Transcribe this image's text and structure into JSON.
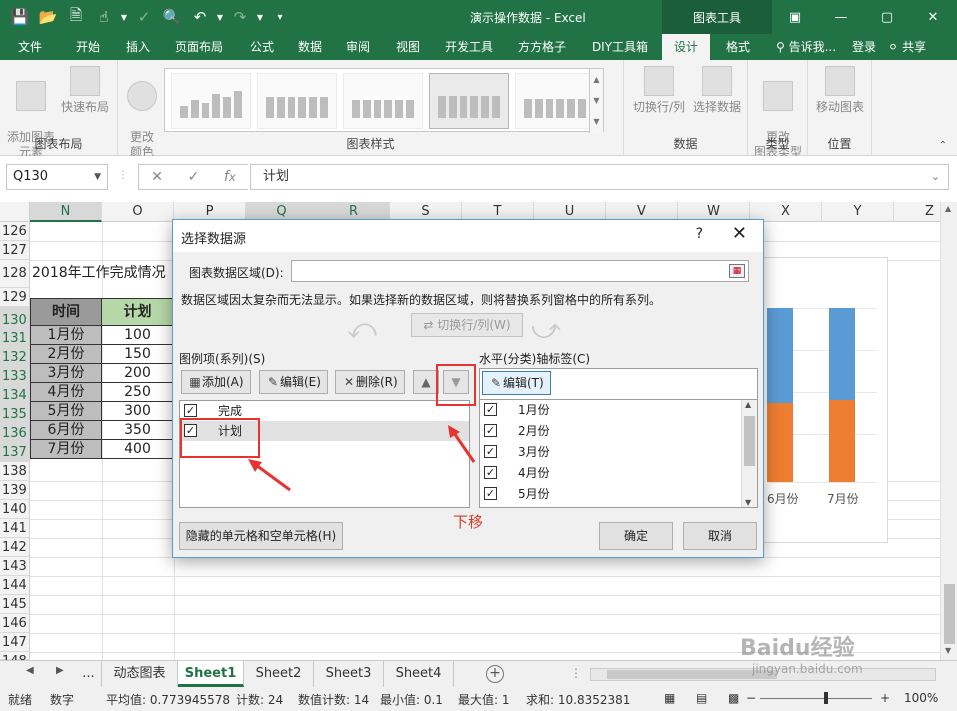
{
  "window": {
    "title": "演示操作数据 - Excel",
    "context_tab": "图表工具"
  },
  "ribbon_tabs": [
    "文件",
    "开始",
    "插入",
    "页面布局",
    "公式",
    "数据",
    "审阅",
    "视图",
    "开发工具",
    "方方格子",
    "DIY工具箱",
    "设计",
    "格式"
  ],
  "active_tab": "设计",
  "tell_me": "告诉我...",
  "login": "登录",
  "share": "共享",
  "ribbon": {
    "add_chart_element": "添加图表\n元素",
    "quick_layout": "快速布局",
    "change_colors": "更改\n颜色",
    "group_layouts": "图表布局",
    "group_styles": "图表样式",
    "switch_row_col": "切换行/列",
    "select_data": "选择数据",
    "group_data": "数据",
    "change_type": "更改\n图表类型",
    "group_type": "类型",
    "move_chart": "移动图表",
    "group_location": "位置"
  },
  "formula_bar": {
    "name_box": "Q130",
    "formula": "计划"
  },
  "columns": [
    "N",
    "O",
    "P",
    "Q",
    "R",
    "S",
    "T",
    "U",
    "V",
    "W",
    "X",
    "Y",
    "Z"
  ],
  "rows": [
    "126",
    "127",
    "128",
    "129",
    "130",
    "131",
    "132",
    "133",
    "134",
    "135",
    "136",
    "137",
    "138",
    "139",
    "140",
    "141",
    "142",
    "143",
    "144",
    "145",
    "146",
    "147",
    "148"
  ],
  "sheet": {
    "title_cell": "2018年工作完成情况",
    "table_headers": [
      "时间",
      "计划"
    ],
    "table_rows": [
      [
        "1月份",
        "100"
      ],
      [
        "2月份",
        "150"
      ],
      [
        "3月份",
        "200"
      ],
      [
        "4月份",
        "250"
      ],
      [
        "5月份",
        "300"
      ],
      [
        "6月份",
        "350"
      ],
      [
        "7月份",
        "400"
      ]
    ]
  },
  "chart_data": {
    "type": "bar",
    "categories": [
      "6月份",
      "7月份"
    ],
    "colors": {
      "orange": "#ed7d31",
      "blue": "#5b9bd5"
    }
  },
  "dialog": {
    "title": "选择数据源",
    "help": "?",
    "range_label": "图表数据区域(D):",
    "notice": "数据区域因太复杂而无法显示。如果选择新的数据区域，则将替换系列窗格中的所有系列。",
    "switch_button": "切换行/列(W)",
    "legend_label": "图例项(系列)(S)",
    "axis_label": "水平(分类)轴标签(C)",
    "add_button": "添加(A)",
    "edit_button": "编辑(E)",
    "delete_button": "删除(R)",
    "axis_edit_button": "编辑(T)",
    "series": [
      "完成",
      "计划"
    ],
    "axis_items": [
      "1月份",
      "2月份",
      "3月份",
      "4月份",
      "5月份"
    ],
    "hidden_cells_button": "隐藏的单元格和空单元格(H)",
    "ok_button": "确定",
    "cancel_button": "取消"
  },
  "annotation": {
    "move_down": "下移"
  },
  "sheet_tabs": [
    "动态图表",
    "Sheet1",
    "Sheet2",
    "Sheet3",
    "Sheet4"
  ],
  "active_sheet": "Sheet1",
  "sheet_ellipsis": "...",
  "status": {
    "ready": "就绪",
    "numlock": "数字",
    "avg": "平均值: 0.773945578",
    "count": "计数: 24",
    "numcount": "数值计数: 14",
    "min": "最小值: 0.1",
    "max": "最大值: 1",
    "sum": "求和: 10.8352381",
    "zoom": "100%"
  },
  "watermark": {
    "brand": "Baidu经验",
    "url": "jingyan.baidu.com"
  }
}
